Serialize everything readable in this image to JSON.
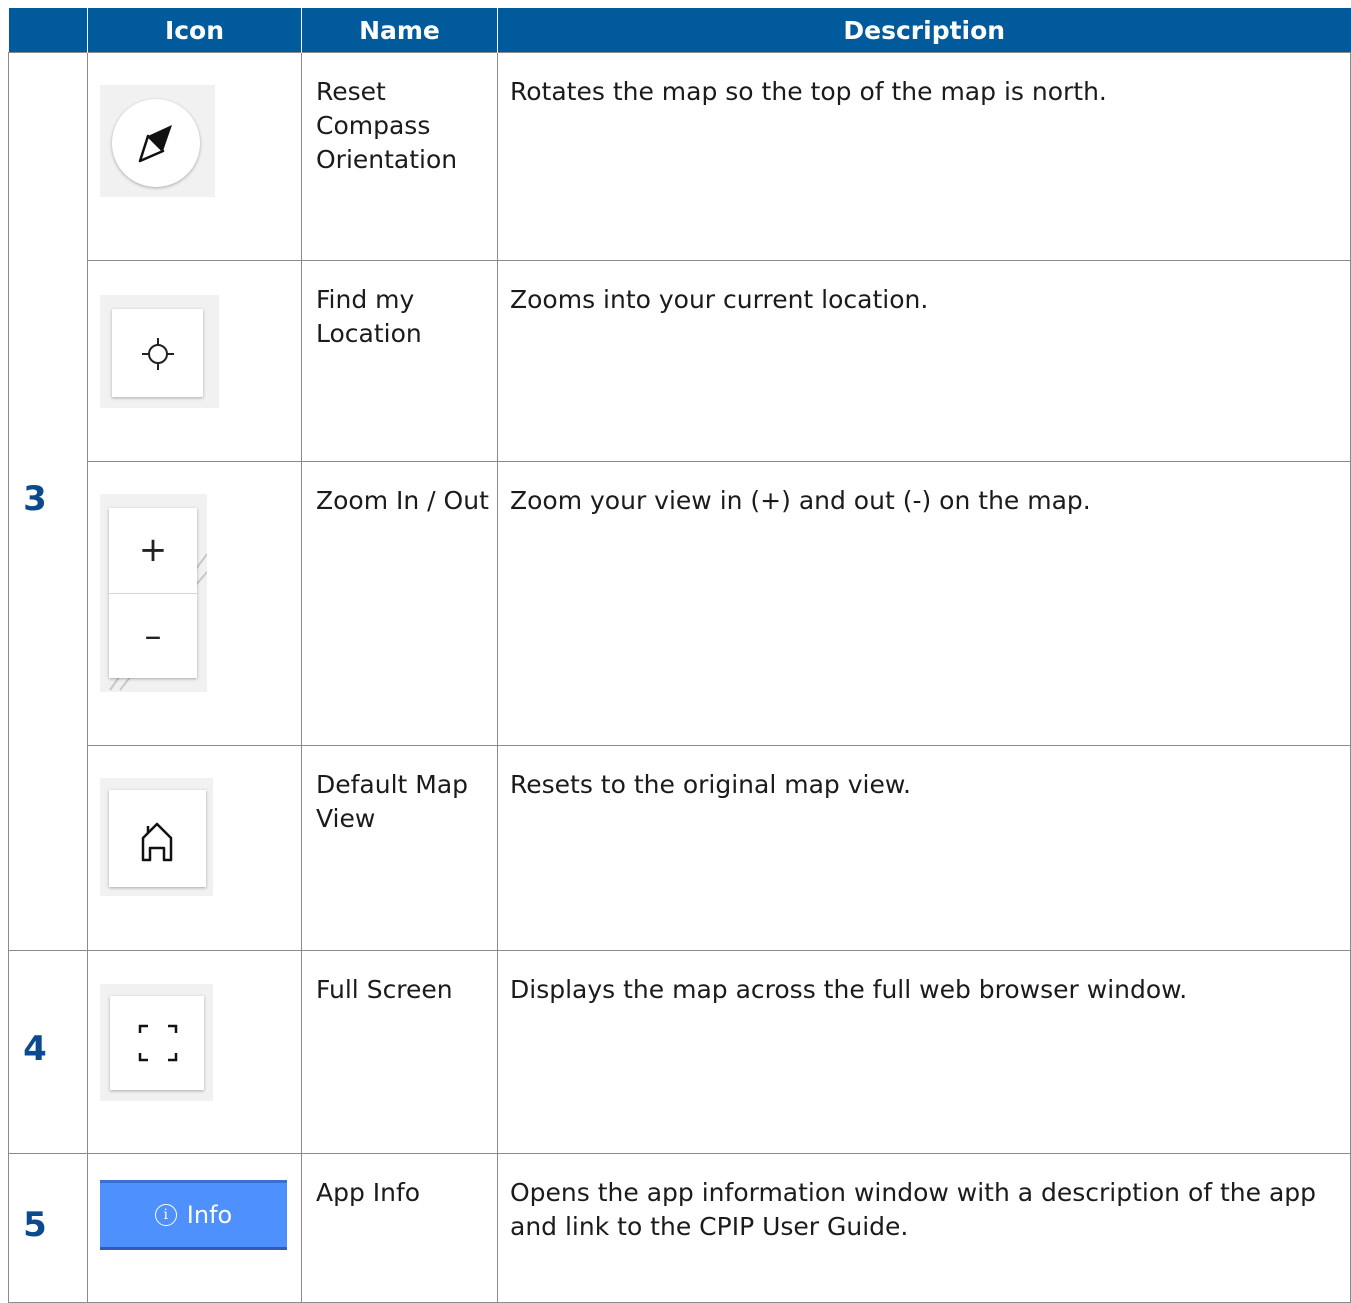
{
  "header": {
    "col_num": "",
    "col_icon": "Icon",
    "col_name": "Name",
    "col_desc": "Description"
  },
  "rows": [
    {
      "number": "3",
      "name": "Reset Compass Orientation",
      "description": "Rotates the map so the top of the map is north.",
      "icon": "compass-icon"
    },
    {
      "name": "Find my Location",
      "description": "Zooms into your current location.",
      "icon": "crosshair-icon"
    },
    {
      "name": "Zoom In / Out",
      "description": "Zoom your view in (+) and out (-) on the map.",
      "icon": "zoom-in-out-icon",
      "plus": "+",
      "minus": "–"
    },
    {
      "name": "Default Map View",
      "description": "Resets to the original map view.",
      "icon": "home-icon"
    },
    {
      "number": "4",
      "name": "Full Screen",
      "description": "Displays the map across the full web browser window.",
      "icon": "fullscreen-icon"
    },
    {
      "number": "5",
      "name": "App Info",
      "description": "Opens the app information window with a description of the app and link to the CPIP User Guide.",
      "icon": "info-icon",
      "button_label": "Info",
      "button_glyph": "i"
    }
  ],
  "colors": {
    "header_bg": "#005a9c",
    "number_color": "#0b4a8c",
    "info_button": "#4d90fe"
  }
}
